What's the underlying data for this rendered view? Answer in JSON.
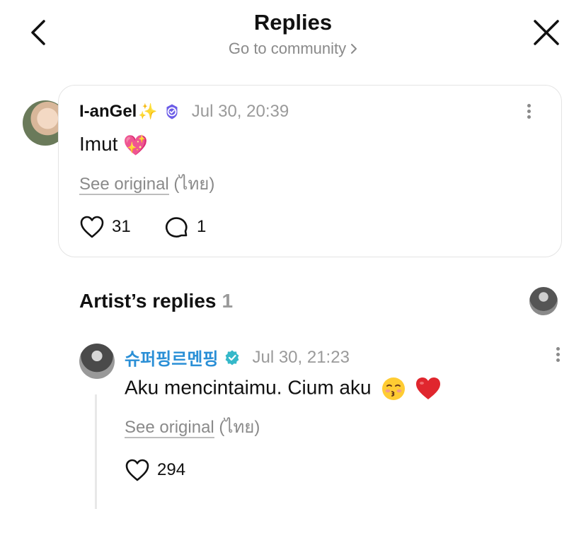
{
  "header": {
    "title": "Replies",
    "subtitle": "Go to community"
  },
  "comment": {
    "username": "I-anGel",
    "name_emoji": "✨",
    "timestamp": "Jul 30, 20:39",
    "text": "Imut",
    "text_emoji": "💖",
    "see_original": "See original",
    "language": "(ไทย)",
    "likes": "31",
    "replies": "1"
  },
  "artist_section": {
    "title": "Artist’s replies",
    "count": "1"
  },
  "artist_reply": {
    "username": "슈퍼핑르멘핑",
    "timestamp": "Jul 30, 21:23",
    "text": "Aku mencintaimu. Cium aku",
    "see_original": "See original",
    "language": "(ไทย)",
    "likes": "294"
  },
  "colors": {
    "artist_name": "#2a8fd6",
    "verified_purple": "#6b5ce7",
    "verified_teal": "#35b8c9",
    "muted": "#8a8a8a"
  }
}
